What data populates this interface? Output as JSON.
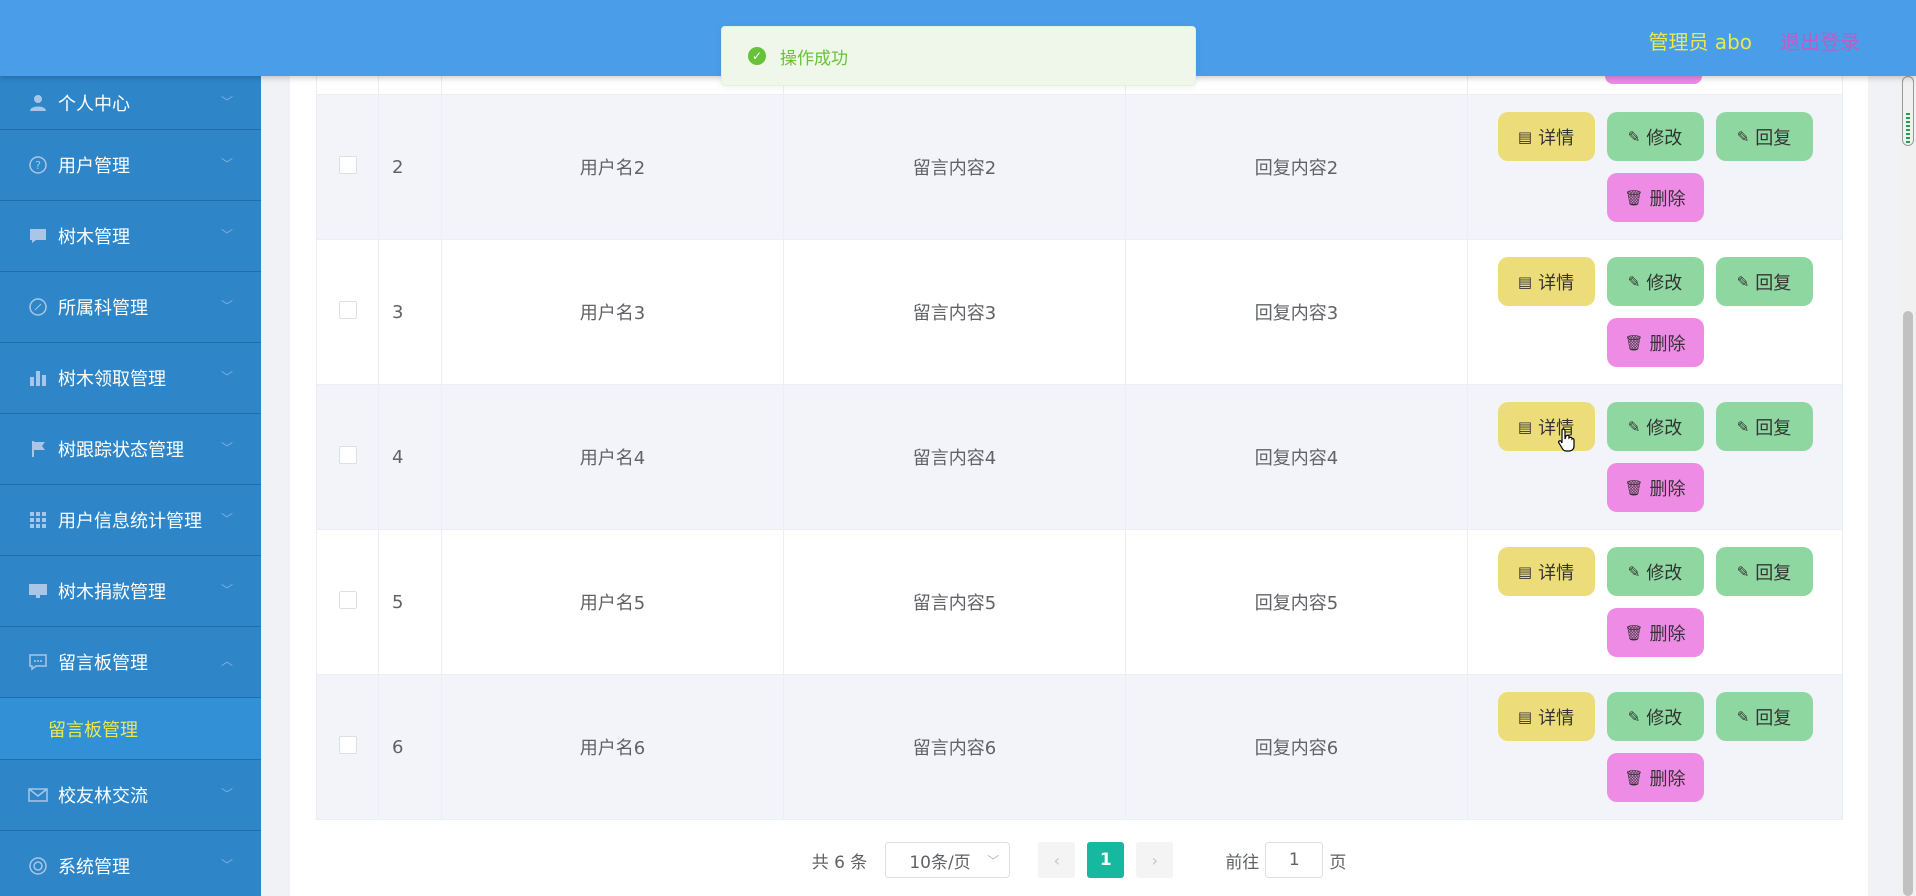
{
  "header": {
    "user_label": "管理员 abo",
    "logout_label": "退出登录"
  },
  "toast": {
    "message": "操作成功",
    "icon": "check-circle-icon"
  },
  "sidebar": {
    "items": [
      {
        "label": "个人中心",
        "icon": "user-icon",
        "expanded": false
      },
      {
        "label": "用户管理",
        "icon": "help-circle-icon",
        "expanded": false
      },
      {
        "label": "树木管理",
        "icon": "message-icon",
        "expanded": false
      },
      {
        "label": "所属科管理",
        "icon": "compass-icon",
        "expanded": false
      },
      {
        "label": "树木领取管理",
        "icon": "bar-chart-icon",
        "expanded": false
      },
      {
        "label": "树跟踪状态管理",
        "icon": "flag-icon",
        "expanded": false
      },
      {
        "label": "用户信息统计管理",
        "icon": "grid-icon",
        "expanded": false
      },
      {
        "label": "树木捐款管理",
        "icon": "monitor-icon",
        "expanded": false
      },
      {
        "label": "留言板管理",
        "icon": "chat-icon",
        "expanded": true
      },
      {
        "label": "校友林交流",
        "icon": "mail-icon",
        "expanded": false
      },
      {
        "label": "系统管理",
        "icon": "settings-icon",
        "expanded": false
      }
    ],
    "active_sub": "留言板管理"
  },
  "table": {
    "rows": [
      {
        "index": "2",
        "username": "用户名2",
        "content": "留言内容2",
        "reply": "回复内容2"
      },
      {
        "index": "3",
        "username": "用户名3",
        "content": "留言内容3",
        "reply": "回复内容3"
      },
      {
        "index": "4",
        "username": "用户名4",
        "content": "留言内容4",
        "reply": "回复内容4"
      },
      {
        "index": "5",
        "username": "用户名5",
        "content": "留言内容5",
        "reply": "回复内容5"
      },
      {
        "index": "6",
        "username": "用户名6",
        "content": "留言内容6",
        "reply": "回复内容6"
      }
    ],
    "actions": {
      "detail": "详情",
      "edit": "修改",
      "reply": "回复",
      "delete": "删除"
    }
  },
  "pagination": {
    "total_label": "共 6 条",
    "page_size": "10条/页",
    "current_page": "1",
    "goto_prefix": "前往",
    "goto_value": "1",
    "goto_suffix": "页"
  },
  "colors": {
    "header": "#4a9de8",
    "sidebar": "#2e86c9",
    "detail_button": "#ecdc7a",
    "edit_button": "#8fd7a0",
    "delete_button": "#ee8be5",
    "active_page": "#16b9a0"
  }
}
